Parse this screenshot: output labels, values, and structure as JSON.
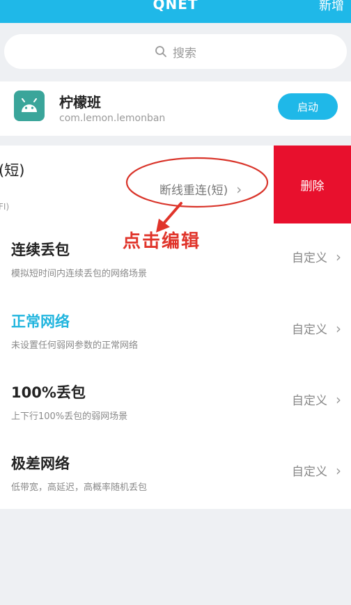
{
  "header": {
    "title": "QNET",
    "action": "新增"
  },
  "search": {
    "placeholder": "搜索"
  },
  "app": {
    "name": "柠檬班",
    "package": "com.lemon.lemonban",
    "start_label": "启动"
  },
  "swiped_row": {
    "title": "(短)",
    "subtitle": "FI)",
    "action": "断线重连(短)",
    "delete_label": "删除"
  },
  "annotation": {
    "text": "点击编辑",
    "color": "#e0342a"
  },
  "rows": [
    {
      "title": "连续丢包",
      "desc": "模拟短时间内连续丢包的网络场景",
      "action": "自定义"
    },
    {
      "title": "正常网络",
      "desc": "未设置任何弱网参数的正常网络",
      "action": "自定义"
    },
    {
      "title": "100%丢包",
      "desc": "上下行100%丢包的弱网场景",
      "action": "自定义"
    },
    {
      "title": "极差网络",
      "desc": "低带宽，高延迟，高概率随机丢包",
      "action": "自定义"
    }
  ],
  "colors": {
    "accent": "#1fb8e8",
    "delete": "#e8102d"
  }
}
